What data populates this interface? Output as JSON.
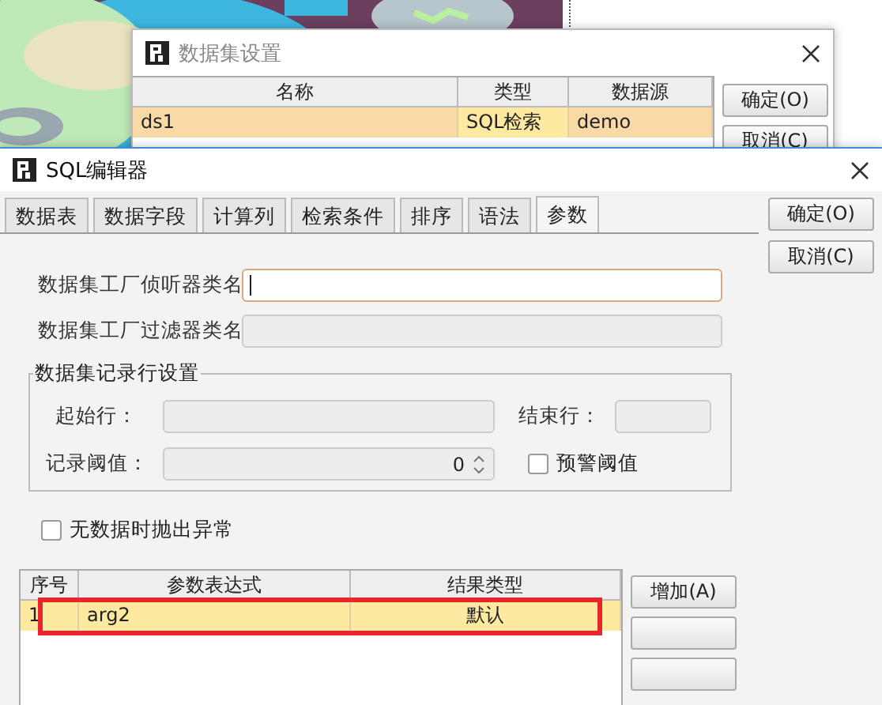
{
  "dataset_dialog": {
    "title": "数据集设置",
    "columns": [
      "名称",
      "类型",
      "数据源"
    ],
    "rows": [
      {
        "cells": [
          "ds1",
          "SQL检索",
          "demo"
        ],
        "selected": true
      }
    ],
    "buttons": [
      "确定(O)",
      "取消(C)"
    ]
  },
  "sql_editor": {
    "title": "SQL编辑器",
    "tabs": [
      {
        "label": "数据表",
        "selected": false
      },
      {
        "label": "数据字段",
        "selected": false
      },
      {
        "label": "计算列",
        "selected": false
      },
      {
        "label": "检索条件",
        "selected": false
      },
      {
        "label": "排序",
        "selected": false
      },
      {
        "label": "语法",
        "selected": false
      },
      {
        "label": "参数",
        "selected": true
      }
    ],
    "buttons": [
      "确定(O)",
      "取消(C)"
    ],
    "fields": [
      {
        "label": "数据集工厂侦听器类名",
        "focused": true,
        "disabled": false
      },
      {
        "label": "数据集工厂过滤器类名",
        "focused": false,
        "disabled": true
      }
    ],
    "record_group": {
      "title": "数据集记录行设置",
      "start_label": "起始行：",
      "end_label": "结束行：",
      "threshold_label": "记录阈值：",
      "threshold_value": "0",
      "warn_checkbox": {
        "label": "预警阈值",
        "checked": false
      }
    },
    "no_data_checkbox": {
      "label": "无数据时抛出异常",
      "checked": false
    },
    "params_table": {
      "columns": [
        "序号",
        "参数表达式",
        "结果类型"
      ],
      "rows": [
        {
          "cells": [
            "1",
            "arg2",
            "默认"
          ],
          "selected": true
        }
      ],
      "highlight_box": true
    },
    "param_buttons": [
      {
        "kind": "labeled",
        "label": "增加(A)"
      },
      {
        "kind": "blank"
      },
      {
        "kind": "blank"
      }
    ]
  }
}
